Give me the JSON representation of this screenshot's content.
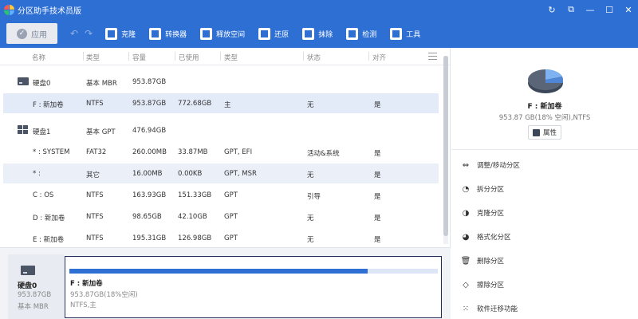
{
  "app": {
    "title": "分区助手技术员版"
  },
  "window_controls": [
    "↻",
    "⧉",
    "—",
    "☐",
    "✕"
  ],
  "toolbar": {
    "apply_label": "应用",
    "undo_symbol": "↶",
    "redo_symbol": "↷",
    "buttons": [
      {
        "label": "克隆",
        "icon": "clone-icon"
      },
      {
        "label": "转换器",
        "icon": "converter-icon"
      },
      {
        "label": "释放空间",
        "icon": "free-space-icon"
      },
      {
        "label": "还原",
        "icon": "restore-icon"
      },
      {
        "label": "抹除",
        "icon": "wipe-icon"
      },
      {
        "label": "检测",
        "icon": "check-icon"
      },
      {
        "label": "工具",
        "icon": "tools-icon"
      }
    ]
  },
  "table": {
    "columns": [
      "名称",
      "类型",
      "容量",
      "已使用",
      "类型",
      "状态",
      "对齐"
    ],
    "rows": [
      {
        "kind": "disk",
        "name": "硬盘0",
        "type": "基本 MBR",
        "capacity": "953.87GB",
        "used": "",
        "fs": "",
        "status": "",
        "align": ""
      },
      {
        "kind": "part",
        "name": "F : 新加卷",
        "type": "NTFS",
        "capacity": "953.87GB",
        "used": "772.68GB",
        "fs": "主",
        "status": "无",
        "align": "是",
        "selected": true
      },
      {
        "kind": "disk2",
        "name": "硬盘1",
        "type": "基本 GPT",
        "capacity": "476.94GB",
        "used": "",
        "fs": "",
        "status": "",
        "align": ""
      },
      {
        "kind": "part",
        "name": "* : SYSTEM",
        "type": "FAT32",
        "capacity": "260.00MB",
        "used": "33.87MB",
        "fs": "GPT, EFI",
        "status": "活动&系统",
        "align": "是"
      },
      {
        "kind": "part",
        "name": "* :",
        "type": "其它",
        "capacity": "16.00MB",
        "used": "0.00KB",
        "fs": "GPT, MSR",
        "status": "无",
        "align": "是",
        "hover": true
      },
      {
        "kind": "part",
        "name": "C : OS",
        "type": "NTFS",
        "capacity": "163.93GB",
        "used": "151.33GB",
        "fs": "GPT",
        "status": "引导",
        "align": "是"
      },
      {
        "kind": "part",
        "name": "D : 新加卷",
        "type": "NTFS",
        "capacity": "98.65GB",
        "used": "42.10GB",
        "fs": "GPT",
        "status": "无",
        "align": "是"
      },
      {
        "kind": "part",
        "name": "E : 新加卷",
        "type": "NTFS",
        "capacity": "195.31GB",
        "used": "126.98GB",
        "fs": "GPT",
        "status": "无",
        "align": "是"
      }
    ]
  },
  "diskmap": {
    "disk_name": "硬盘0",
    "disk_size": "953.87GB",
    "disk_type": "基本 MBR",
    "partition_name": "F : 新加卷",
    "partition_size": "953.87GB(18%空闲)",
    "partition_fs": "NTFS,主",
    "used_fraction": 0.81
  },
  "right_panel": {
    "name": "F : 新加卷",
    "info": "953.87 GB(18% 空闲),NTFS",
    "property_label": "属性",
    "operations": [
      {
        "label": "调整/移动分区",
        "icon": "resize-icon",
        "glyph": "⇔"
      },
      {
        "label": "拆分分区",
        "icon": "split-icon",
        "glyph": "◔"
      },
      {
        "label": "克隆分区",
        "icon": "clone-partition-icon",
        "glyph": "◑"
      },
      {
        "label": "格式化分区",
        "icon": "format-icon",
        "glyph": "◕"
      },
      {
        "label": "删除分区",
        "icon": "delete-icon",
        "glyph": "🗑"
      },
      {
        "label": "擦除分区",
        "icon": "eraser-icon",
        "glyph": "◇"
      },
      {
        "label": "软件迁移功能",
        "icon": "migrate-icon",
        "glyph": "⁙"
      }
    ]
  },
  "colors": {
    "titlebar": "#2e6fd3",
    "selected_row": "#e3ebf8",
    "bar_fill": "#2e6fd3"
  }
}
